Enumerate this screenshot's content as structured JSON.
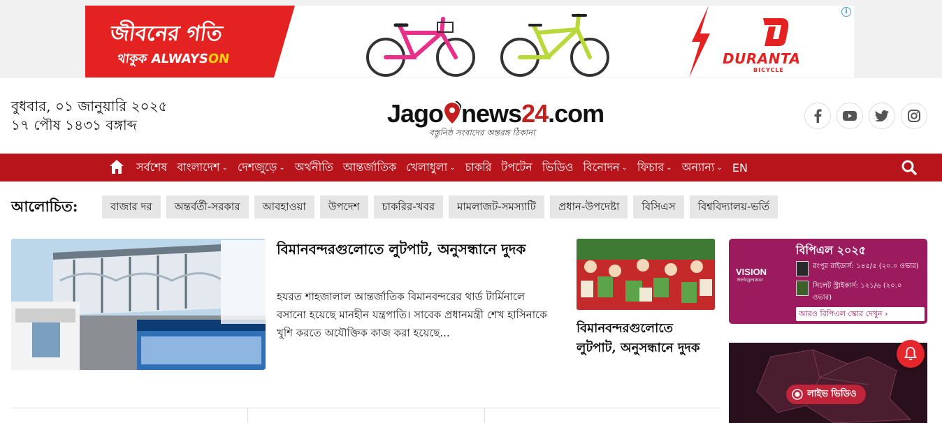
{
  "ad": {
    "headline": "জীবনের গতি",
    "tagline_pre": "থাকুক ALWAYS",
    "tagline_on": "ON",
    "brand": "DURANTA",
    "brand_sub": "BICYCLE",
    "info_icon": "i"
  },
  "header": {
    "date_line1": "বুধবার, ০১ জানুয়ারি ২০২৫",
    "date_line2": "১৭ পৌষ ১৪৩১ বঙ্গাব্দ",
    "logo_a": "Jago",
    "logo_b": "news",
    "logo_c": "24",
    "logo_d": ".com",
    "logo_tagline": "বস্তুনিষ্ঠ সংবাদের অন্তরঙ্গ ঠিকানা",
    "social": [
      "facebook-icon",
      "youtube-icon",
      "twitter-icon",
      "instagram-icon"
    ]
  },
  "nav": {
    "items": [
      {
        "label": "সর্বশেষ",
        "dropdown": false
      },
      {
        "label": "বাংলাদেশ",
        "dropdown": true
      },
      {
        "label": "দেশজুড়ে",
        "dropdown": true
      },
      {
        "label": "অর্থনীতি",
        "dropdown": false
      },
      {
        "label": "আন্তর্জাতিক",
        "dropdown": false
      },
      {
        "label": "খেলাধুলা",
        "dropdown": true
      },
      {
        "label": "চাকরি",
        "dropdown": false
      },
      {
        "label": "টপটেন",
        "dropdown": false
      },
      {
        "label": "ভিডিও",
        "dropdown": false
      },
      {
        "label": "বিনোদন",
        "dropdown": true
      },
      {
        "label": "ফিচার",
        "dropdown": true
      },
      {
        "label": "অন্যান্য",
        "dropdown": true
      },
      {
        "label": "EN",
        "dropdown": false
      }
    ]
  },
  "trending": {
    "label": "আলোচিত:",
    "tags": [
      "বাজার দর",
      "অন্তর্বর্তী-সরকার",
      "আবহাওয়া",
      "উপদেশ",
      "চাকরির-খবর",
      "মামলাজট-সমস্যাটি",
      "প্রধান-উপদেষ্টা",
      "বিসিএস",
      "বিশ্ববিদ্যালয়-ভর্তি"
    ]
  },
  "lead": {
    "title": "বিমানবন্দরগুলোতে লুটপাট, অনুসন্ধানে দুদক",
    "summary": "হযরত শাহজালাল আন্তর্জাতিক বিমানবন্দরের থার্ড টার্মিনালে বসানো হয়েছে মানহীন যন্ত্রপাতি। সাবেক প্রধানমন্ত্রী শেখ হাসিনাকে খুশি করতে অযৌক্তিক কাজ করা হয়েছে..."
  },
  "second": {
    "title": "বিমানবন্দরগুলোতে লুটপাট, অনুসন্ধানে দুদক"
  },
  "bpl": {
    "title": "বিপিএল ২০২৫",
    "sponsor": "VISION",
    "sponsor_sub": "Refrigerator",
    "score1": "রংপুর রাইডার্স: ১৪৫/৫ (২০.০ ওভার)",
    "score2": "সিলেট স্ট্রাইকার্স: ১২১/৬ (২০.০ ওভার)",
    "more": "আরও বিপিএল স্কোর দেখুন ›"
  },
  "live": {
    "label": "লাইভ ভিডিও"
  },
  "colors": {
    "nav_bg": "#b8141b",
    "bpl_bg": "#9b1b5e",
    "brand_red": "#e42222"
  }
}
